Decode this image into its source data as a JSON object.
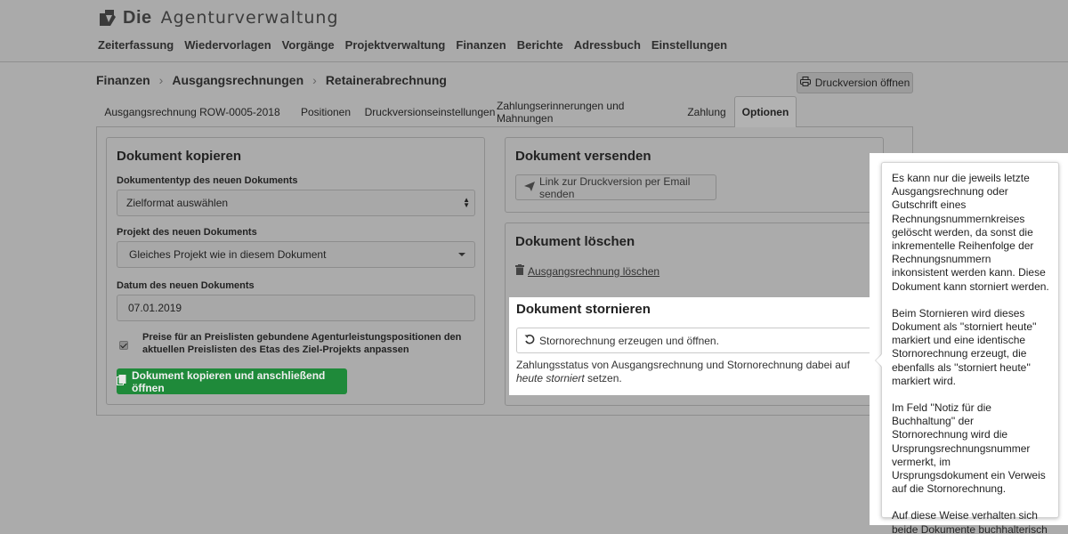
{
  "app": {
    "logo_bold": "Die",
    "logo_name": "Agenturverwaltung"
  },
  "nav": [
    "Zeiterfassung",
    "Wiedervorlagen",
    "Vorgänge",
    "Projektverwaltung",
    "Finanzen",
    "Berichte",
    "Adressbuch",
    "Einstellungen"
  ],
  "breadcrumb": [
    "Finanzen",
    "Ausgangsrechnungen",
    "Retainerabrechnung"
  ],
  "print_button": "Druckversion öffnen",
  "tabs": [
    {
      "label": "Ausgangsrechnung ROW-0005-2018",
      "active": false
    },
    {
      "label": "Positionen",
      "active": false
    },
    {
      "label": "Druckversionseinstellungen",
      "active": false
    },
    {
      "label": "Zahlungserinnerungen und Mahnungen",
      "active": false
    },
    {
      "label": "Zahlung",
      "active": false
    },
    {
      "label": "Optionen",
      "active": true
    }
  ],
  "copy": {
    "title": "Dokument kopieren",
    "doctype_label": "Dokumententyp des neuen Dokuments",
    "doctype_value": "Zielformat auswählen",
    "project_label": "Projekt des neuen Dokuments",
    "project_value": "Gleiches Projekt wie in diesem Dokument",
    "date_label": "Datum des neuen Dokuments",
    "date_value": "07.01.2019",
    "checkbox_label": "Preise für an Preislisten gebundene Agenturleistungspositionen den aktuellen Preislisten des Etas des Ziel-Projekts anpassen",
    "checkbox_checked": true,
    "submit_label": "Dokument kopieren und anschließend öffnen"
  },
  "send": {
    "title": "Dokument versenden",
    "button_label": "Link zur Druckversion per Email senden"
  },
  "delete": {
    "title": "Dokument löschen",
    "link_label": "Ausgangsrechnung löschen"
  },
  "storno": {
    "title": "Dokument stornieren",
    "button_label": "Stornorechnung erzeugen und öffnen.",
    "text_before": "Zahlungsstatus von Ausgangsrechnung und Stornorechnung dabei auf ",
    "text_italic": "heute storniert",
    "text_after": " setzen."
  },
  "tooltip": {
    "paragraphs": [
      "Es kann nur die jeweils letzte Ausgangsrechnung oder Gutschrift eines Rechnungsnummernkreises gelöscht werden, da sonst die inkrementelle Reihenfolge der Rechnungsnummern inkonsistent werden kann. Diese Dokument kann storniert werden.",
      "Beim Stornieren wird dieses Dokument als ''storniert heute'' markiert und eine identische Stornorechnung erzeugt, die ebenfalls als ''storniert heute'' markiert wird.",
      "Im Feld ''Notiz für die Buchhaltung'' der Stornorechnung wird die Ursprungsrechnungsnummer vermerkt, im Ursprungsdokument ein Verweis auf die Stornorechnung.",
      "Auf diese Weise verhalten sich beide Dokumente buchhalterisch neutral."
    ]
  },
  "colors": {
    "background": "#ababab",
    "green_button": "#1f8a3a",
    "highlight": "#ffffff"
  }
}
